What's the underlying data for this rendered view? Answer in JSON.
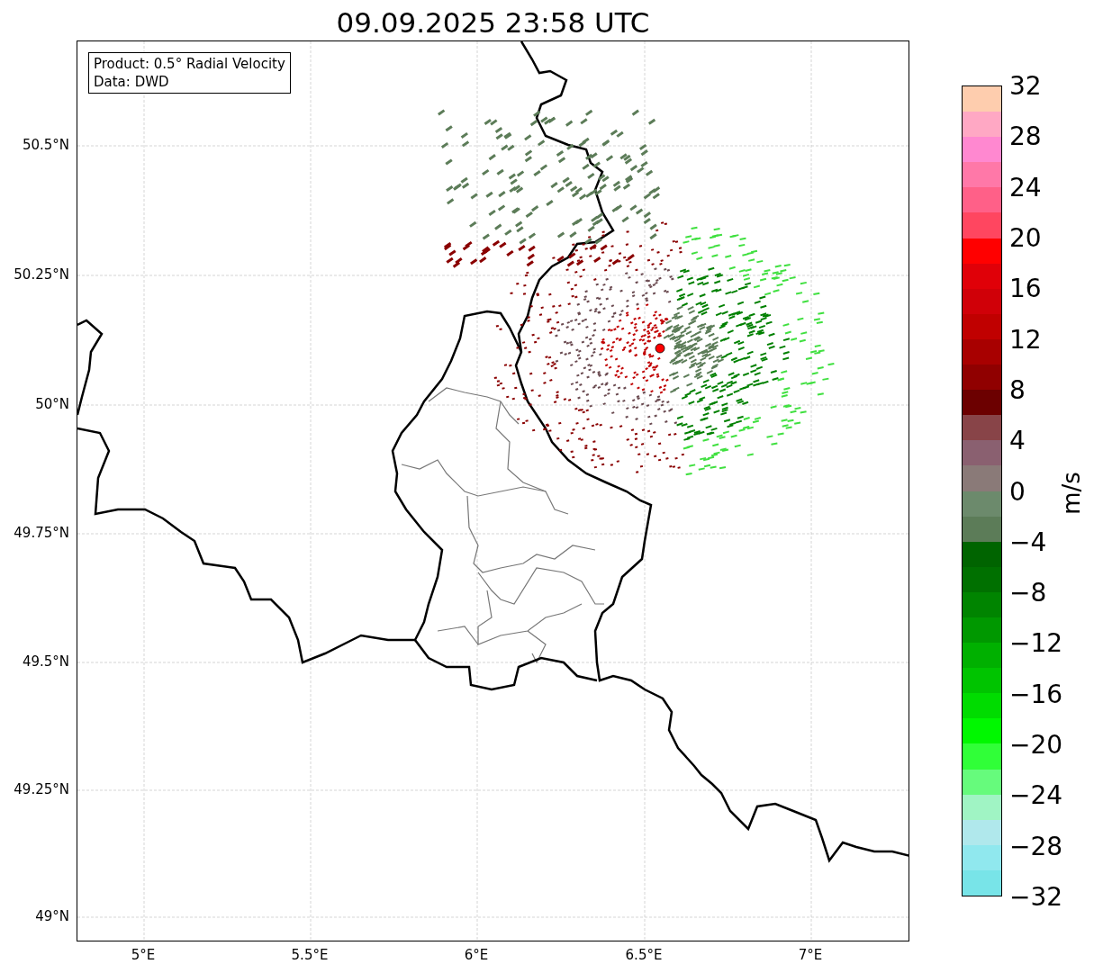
{
  "title": "09.09.2025 23:58 UTC",
  "info_box": {
    "lines": [
      "Product: 0.5° Radial Velocity",
      "Data: DWD"
    ]
  },
  "map": {
    "y_ticks": [
      "50.5°N",
      "50.25°N",
      "50°N",
      "49.75°N",
      "49.5°N",
      "49.25°N",
      "49°N"
    ],
    "x_ticks": [
      "5°E",
      "5.5°E",
      "6°E",
      "6.5°E",
      "7°E"
    ]
  },
  "colorbar": {
    "label": "m/s",
    "ticks": [
      "32",
      "28",
      "24",
      "20",
      "16",
      "12",
      "8",
      "4",
      "0",
      "−4",
      "−8",
      "−12",
      "−16",
      "−20",
      "−24",
      "−28",
      "−32"
    ],
    "bands": [
      {
        "color": "#fecdae"
      },
      {
        "color": "#ffa8c4"
      },
      {
        "color": "#ff88d0"
      },
      {
        "color": "#ff78a8"
      },
      {
        "color": "#ff6088"
      },
      {
        "color": "#ff4660"
      },
      {
        "color": "#ff0000"
      },
      {
        "color": "#e00008"
      },
      {
        "color": "#d00008"
      },
      {
        "color": "#c00000"
      },
      {
        "color": "#a80000"
      },
      {
        "color": "#900000"
      },
      {
        "color": "#6c0000"
      },
      {
        "color": "#884448"
      },
      {
        "color": "#8a6070"
      },
      {
        "color": "#8a7a78"
      },
      {
        "color": "#6c8a6c"
      },
      {
        "color": "#5c7c58"
      },
      {
        "color": "#006400"
      },
      {
        "color": "#007000"
      },
      {
        "color": "#008400"
      },
      {
        "color": "#009800"
      },
      {
        "color": "#00b000"
      },
      {
        "color": "#00c400"
      },
      {
        "color": "#00dc00"
      },
      {
        "color": "#00f800"
      },
      {
        "color": "#30ff38"
      },
      {
        "color": "#66fb7c"
      },
      {
        "color": "#a0f4c4"
      },
      {
        "color": "#b0e8ec"
      },
      {
        "color": "#90e8ee"
      },
      {
        "color": "#78e4e8"
      }
    ]
  }
}
